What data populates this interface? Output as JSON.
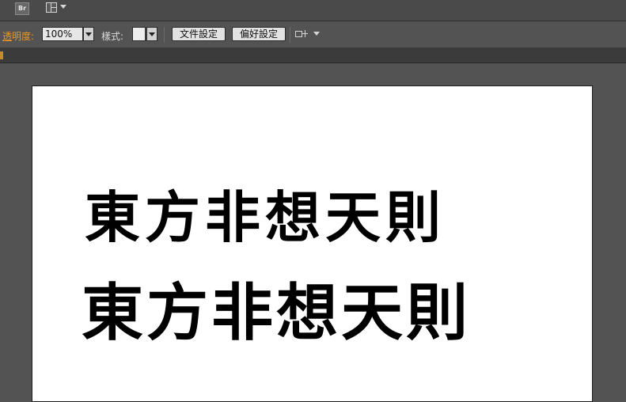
{
  "topbar": {
    "bridge_label": "Br",
    "icons": [
      "bridge-icon",
      "arrange-documents-icon",
      "chevron-down-icon"
    ]
  },
  "controlbar": {
    "opacity_label_underlined": "透",
    "opacity_label_rest": "明度:",
    "opacity_value": "100%",
    "style_label": "樣式:",
    "document_setup_button": "文件設定",
    "preferences_button": "偏好設定",
    "arrange_icon": "arrange-icon"
  },
  "colors": {
    "accent": "#e8962b",
    "background": "#535353",
    "artboard": "#ffffff"
  },
  "artboard": {
    "line1": "東方非想天則",
    "line2": "東方非想天則"
  }
}
